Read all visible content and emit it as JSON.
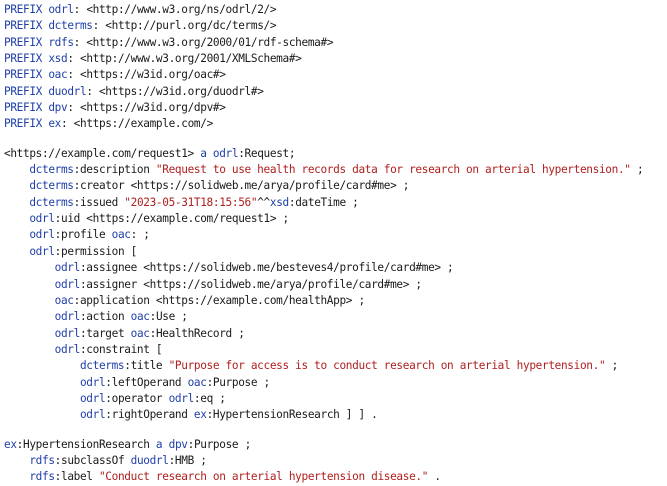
{
  "document": {
    "lines": [
      [
        {
          "t": "kw",
          "v": "PREFIX"
        },
        {
          "t": "txt",
          "v": " "
        },
        {
          "t": "pfx",
          "v": "odrl"
        },
        {
          "t": "txt",
          "v": ": <http://www.w3.org/ns/odrl/2/>"
        }
      ],
      [
        {
          "t": "kw",
          "v": "PREFIX"
        },
        {
          "t": "txt",
          "v": " "
        },
        {
          "t": "pfx",
          "v": "dcterms"
        },
        {
          "t": "txt",
          "v": ": <http://purl.org/dc/terms/>"
        }
      ],
      [
        {
          "t": "kw",
          "v": "PREFIX"
        },
        {
          "t": "txt",
          "v": " "
        },
        {
          "t": "pfx",
          "v": "rdfs"
        },
        {
          "t": "txt",
          "v": ": <http://www.w3.org/2000/01/rdf-schema#>"
        }
      ],
      [
        {
          "t": "kw",
          "v": "PREFIX"
        },
        {
          "t": "txt",
          "v": " "
        },
        {
          "t": "pfx",
          "v": "xsd"
        },
        {
          "t": "txt",
          "v": ": <http://www.w3.org/2001/XMLSchema#>"
        }
      ],
      [
        {
          "t": "kw",
          "v": "PREFIX"
        },
        {
          "t": "txt",
          "v": " "
        },
        {
          "t": "pfx",
          "v": "oac"
        },
        {
          "t": "txt",
          "v": ": <https://w3id.org/oac#>"
        }
      ],
      [
        {
          "t": "kw",
          "v": "PREFIX"
        },
        {
          "t": "txt",
          "v": " "
        },
        {
          "t": "pfx",
          "v": "duodrl"
        },
        {
          "t": "txt",
          "v": ": <https://w3id.org/duodrl#>"
        }
      ],
      [
        {
          "t": "kw",
          "v": "PREFIX"
        },
        {
          "t": "txt",
          "v": " "
        },
        {
          "t": "pfx",
          "v": "dpv"
        },
        {
          "t": "txt",
          "v": ": <https://w3id.org/dpv#>"
        }
      ],
      [
        {
          "t": "kw",
          "v": "PREFIX"
        },
        {
          "t": "txt",
          "v": " "
        },
        {
          "t": "pfx",
          "v": "ex"
        },
        {
          "t": "txt",
          "v": ": <https://example.com/>"
        }
      ],
      [],
      [
        {
          "t": "txt",
          "v": "<https://example.com/request1> "
        },
        {
          "t": "kw",
          "v": "a"
        },
        {
          "t": "txt",
          "v": " "
        },
        {
          "t": "pfx",
          "v": "odrl"
        },
        {
          "t": "txt",
          "v": ":Request;"
        }
      ],
      [
        {
          "t": "txt",
          "v": "    "
        },
        {
          "t": "pfx",
          "v": "dcterms"
        },
        {
          "t": "txt",
          "v": ":description "
        },
        {
          "t": "str",
          "v": "\"Request to use health records data for research on arterial hypertension.\""
        },
        {
          "t": "txt",
          "v": " ;"
        }
      ],
      [
        {
          "t": "txt",
          "v": "    "
        },
        {
          "t": "pfx",
          "v": "dcterms"
        },
        {
          "t": "txt",
          "v": ":creator <https://solidweb.me/arya/profile/card#me> ;"
        }
      ],
      [
        {
          "t": "txt",
          "v": "    "
        },
        {
          "t": "pfx",
          "v": "dcterms"
        },
        {
          "t": "txt",
          "v": ":issued "
        },
        {
          "t": "str",
          "v": "\"2023-05-31T18:15:56\""
        },
        {
          "t": "txt",
          "v": "^^"
        },
        {
          "t": "pfx",
          "v": "xsd"
        },
        {
          "t": "txt",
          "v": ":dateTime ;"
        }
      ],
      [
        {
          "t": "txt",
          "v": "    "
        },
        {
          "t": "pfx",
          "v": "odrl"
        },
        {
          "t": "txt",
          "v": ":uid <https://example.com/request1> ;"
        }
      ],
      [
        {
          "t": "txt",
          "v": "    "
        },
        {
          "t": "pfx",
          "v": "odrl"
        },
        {
          "t": "txt",
          "v": ":profile "
        },
        {
          "t": "pfx",
          "v": "oac"
        },
        {
          "t": "txt",
          "v": ": ;"
        }
      ],
      [
        {
          "t": "txt",
          "v": "    "
        },
        {
          "t": "pfx",
          "v": "odrl"
        },
        {
          "t": "txt",
          "v": ":permission ["
        }
      ],
      [
        {
          "t": "txt",
          "v": "        "
        },
        {
          "t": "pfx",
          "v": "odrl"
        },
        {
          "t": "txt",
          "v": ":assignee <https://solidweb.me/besteves4/profile/card#me> ;"
        }
      ],
      [
        {
          "t": "txt",
          "v": "        "
        },
        {
          "t": "pfx",
          "v": "odrl"
        },
        {
          "t": "txt",
          "v": ":assigner <https://solidweb.me/arya/profile/card#me> ;"
        }
      ],
      [
        {
          "t": "txt",
          "v": "        "
        },
        {
          "t": "pfx",
          "v": "oac"
        },
        {
          "t": "txt",
          "v": ":application <https://example.com/healthApp> ;"
        }
      ],
      [
        {
          "t": "txt",
          "v": "        "
        },
        {
          "t": "pfx",
          "v": "odrl"
        },
        {
          "t": "txt",
          "v": ":action "
        },
        {
          "t": "pfx",
          "v": "oac"
        },
        {
          "t": "txt",
          "v": ":Use ;"
        }
      ],
      [
        {
          "t": "txt",
          "v": "        "
        },
        {
          "t": "pfx",
          "v": "odrl"
        },
        {
          "t": "txt",
          "v": ":target "
        },
        {
          "t": "pfx",
          "v": "oac"
        },
        {
          "t": "txt",
          "v": ":HealthRecord ;"
        }
      ],
      [
        {
          "t": "txt",
          "v": "        "
        },
        {
          "t": "pfx",
          "v": "odrl"
        },
        {
          "t": "txt",
          "v": ":constraint ["
        }
      ],
      [
        {
          "t": "txt",
          "v": "            "
        },
        {
          "t": "pfx",
          "v": "dcterms"
        },
        {
          "t": "txt",
          "v": ":title "
        },
        {
          "t": "str",
          "v": "\"Purpose for access is to conduct research on arterial hypertension.\""
        },
        {
          "t": "txt",
          "v": " ;"
        }
      ],
      [
        {
          "t": "txt",
          "v": "            "
        },
        {
          "t": "pfx",
          "v": "odrl"
        },
        {
          "t": "txt",
          "v": ":leftOperand "
        },
        {
          "t": "pfx",
          "v": "oac"
        },
        {
          "t": "txt",
          "v": ":Purpose ;"
        }
      ],
      [
        {
          "t": "txt",
          "v": "            "
        },
        {
          "t": "pfx",
          "v": "odrl"
        },
        {
          "t": "txt",
          "v": ":operator "
        },
        {
          "t": "pfx",
          "v": "odrl"
        },
        {
          "t": "txt",
          "v": ":eq ;"
        }
      ],
      [
        {
          "t": "txt",
          "v": "            "
        },
        {
          "t": "pfx",
          "v": "odrl"
        },
        {
          "t": "txt",
          "v": ":rightOperand "
        },
        {
          "t": "pfx",
          "v": "ex"
        },
        {
          "t": "txt",
          "v": ":HypertensionResearch ] ] ."
        }
      ],
      [],
      [
        {
          "t": "pfx",
          "v": "ex"
        },
        {
          "t": "txt",
          "v": ":HypertensionResearch "
        },
        {
          "t": "kw",
          "v": "a"
        },
        {
          "t": "txt",
          "v": " "
        },
        {
          "t": "pfx",
          "v": "dpv"
        },
        {
          "t": "txt",
          "v": ":Purpose ;"
        }
      ],
      [
        {
          "t": "txt",
          "v": "    "
        },
        {
          "t": "pfx",
          "v": "rdfs"
        },
        {
          "t": "txt",
          "v": ":subclassOf "
        },
        {
          "t": "pfx",
          "v": "duodrl"
        },
        {
          "t": "txt",
          "v": ":HMB ;"
        }
      ],
      [
        {
          "t": "txt",
          "v": "    "
        },
        {
          "t": "pfx",
          "v": "rdfs"
        },
        {
          "t": "txt",
          "v": ":label "
        },
        {
          "t": "str",
          "v": "\"Conduct research on arterial hypertension disease.\""
        },
        {
          "t": "txt",
          "v": " ."
        }
      ]
    ]
  }
}
